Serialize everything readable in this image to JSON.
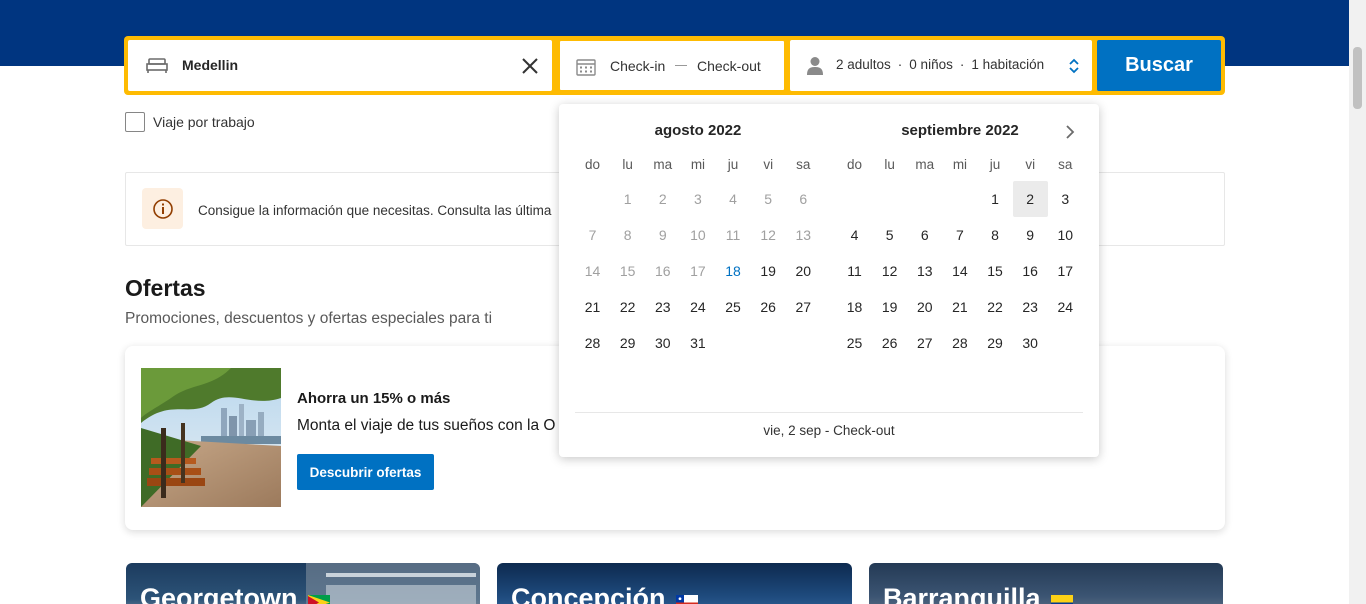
{
  "search": {
    "destination": "Medellin",
    "checkin": "Check-in",
    "checkout": "Check-out",
    "guests": {
      "adults": "2 adultos",
      "children": "0 niños",
      "rooms": "1 habitación",
      "separator": "·"
    },
    "button": "Buscar"
  },
  "work_trip": {
    "label": "Viaje por trabajo"
  },
  "info": {
    "text": "Consigue la información que necesitas. Consulta las última"
  },
  "offers": {
    "title": "Ofertas",
    "subtitle": "Promociones, descuentos y ofertas especiales para ti",
    "card": {
      "headline": "Ahorra un 15% o más",
      "body": "Monta el viaje de tus sueños con la O",
      "button": "Descubrir ofertas"
    }
  },
  "cities": [
    {
      "name": "Georgetown"
    },
    {
      "name": "Concepción"
    },
    {
      "name": "Barranquilla"
    }
  ],
  "calendar": {
    "weekdays": [
      "do",
      "lu",
      "ma",
      "mi",
      "ju",
      "vi",
      "sa"
    ],
    "months": [
      {
        "title": "agosto 2022",
        "lead_blanks": 1,
        "days": 31,
        "today": 18,
        "past_before": 18,
        "selected": null
      },
      {
        "title": "septiembre 2022",
        "lead_blanks": 4,
        "days": 30,
        "today": null,
        "past_before": 0,
        "selected": 2
      }
    ],
    "footer": "vie, 2 sep - Check-out"
  },
  "colors": {
    "brand_dark": "#003580",
    "accent_yellow": "#febb02",
    "primary_blue": "#0071c2"
  }
}
